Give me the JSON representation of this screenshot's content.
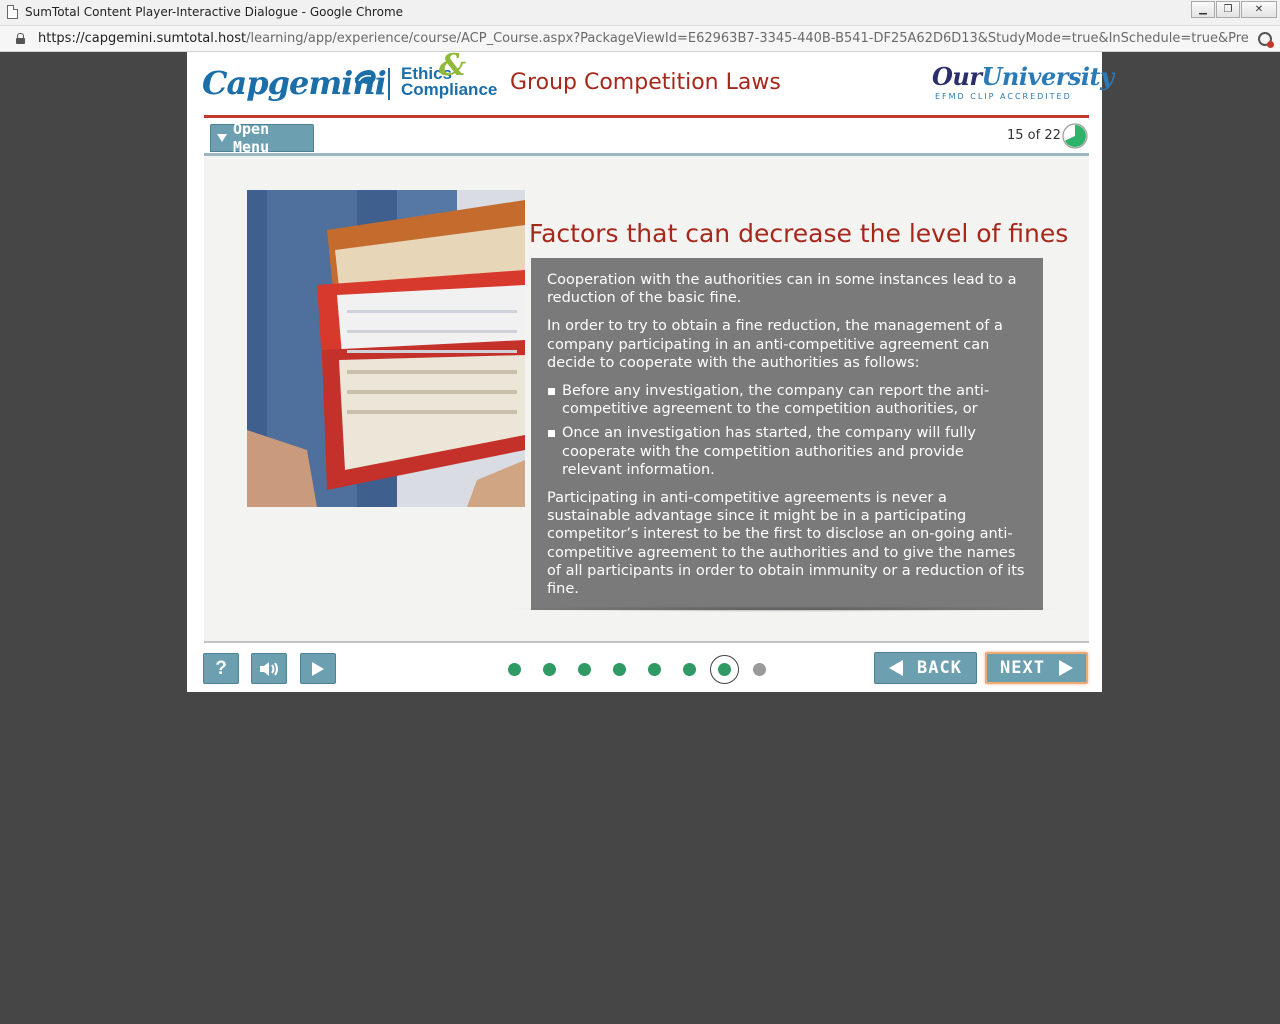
{
  "browser": {
    "window_title": "SumTotal Content Player-Interactive Dialogue - Google Chrome",
    "url_host": "https://capgemini.sumtotal.host",
    "url_path": "/learning/app/experience/course/ACP_Course.aspx?PackageViewId=E62963B7-3345-440B-B541-DF25A62D6D13&StudyMode=true&InSchedule=true&Preview=...",
    "icons": [
      "page-icon",
      "lock-icon",
      "extension-icon",
      "minimize-icon",
      "maximize-icon",
      "close-icon"
    ]
  },
  "header": {
    "brand_logo_text": "Capgemini",
    "ethics_logo_line1": "Ethics",
    "ethics_logo_amp": "&",
    "ethics_logo_line2": "Compliance",
    "course_title": "Group Competition Laws",
    "university_logo_our": "Our",
    "university_logo_name": "University",
    "university_logo_sub": "EFMD CLIP ACCREDITED"
  },
  "menu": {
    "open_menu_label": "Open Menu"
  },
  "progress": {
    "page_counter": "15 of 22",
    "current_page": 15,
    "total_pages": 22
  },
  "slide": {
    "title": "Factors that can decrease the level of fines",
    "paragraph_1": "Cooperation with the authorities can in some instances lead to a reduction of the basic fine.",
    "paragraph_2": "In order to try to obtain a fine reduction, the management of a company participating in an anti-competitive agreement can decide to cooperate with the authorities as follows:",
    "bullets": [
      "Before any investigation, the company can report the anti-competitive agreement to the  competition authorities, or",
      "Once an investigation has started, the company will fully cooperate with the competition authorities and provide relevant information."
    ],
    "paragraph_3": "Participating in anti-competitive agreements is never a sustainable advantage since it might be in a participating competitor’s interest to be the first to disclose an on-going anti-competitive agreement to the authorities and to give the names of all participants in order to obtain immunity or a reduction of its fine.",
    "image_subject": "person-carrying-stack-of-binders"
  },
  "controls": {
    "help_label": "?",
    "back_label": "BACK",
    "next_label": "NEXT"
  },
  "pagination": {
    "dots_total": 8,
    "dots_completed": 7,
    "current_dot": 7
  },
  "colors": {
    "accent_red": "#a5281b",
    "button_blue": "#6c9fb0",
    "dot_green": "#2f9a63",
    "text_box_gray": "#7a7a7a",
    "brand_blue": "#1b6ea8"
  }
}
